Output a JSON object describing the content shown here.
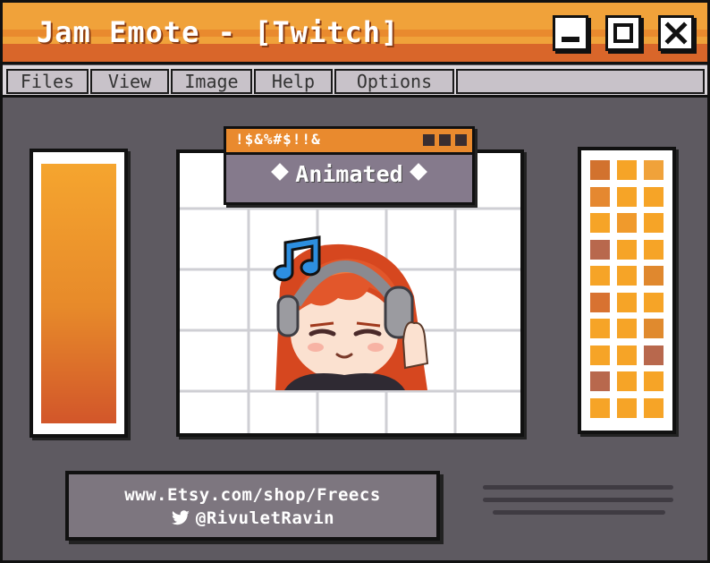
{
  "window": {
    "title": "Jam Emote - [Twitch]",
    "buttons": [
      {
        "name": "minimize",
        "icon": "minimize-icon"
      },
      {
        "name": "maximize",
        "icon": "maximize-icon"
      },
      {
        "name": "close",
        "icon": "close-icon"
      }
    ]
  },
  "menu": {
    "items": [
      "Files",
      "View",
      "Image",
      "Help",
      "Options"
    ]
  },
  "popup": {
    "header": "!$&%#$!!&",
    "label": "Animated"
  },
  "emote": {
    "icon": "music-note-icon",
    "description_icon": "headphones-character-emote"
  },
  "swatches": {
    "colors": [
      [
        "#d2722e",
        "#f6a427",
        "#f0a23a"
      ],
      [
        "#e58830",
        "#f6a427",
        "#f6a427"
      ],
      [
        "#f6a427",
        "#f09a2c",
        "#f6a427"
      ],
      [
        "#b8684d",
        "#f6a427",
        "#f6a427"
      ],
      [
        "#f6a427",
        "#f6a427",
        "#e0882e"
      ],
      [
        "#d87231",
        "#f6a427",
        "#f6a427"
      ],
      [
        "#f6a427",
        "#f6a427",
        "#e08a2e"
      ],
      [
        "#f6a427",
        "#f6a427",
        "#b8684d"
      ],
      [
        "#b8684d",
        "#f6a427",
        "#f6a427"
      ],
      [
        "#f6a427",
        "#f6a427",
        "#f6a427"
      ]
    ]
  },
  "footer": {
    "website": "www.Etsy.com/shop/Freecs",
    "handle": "@RivuletRavin",
    "handle_icon": "twitter-bird-icon"
  },
  "colors": {
    "title_orange": "#f0a23a",
    "title_dark_orange": "#d9662a",
    "body_gray": "#5e5a61",
    "popup_purple": "#857a8c"
  }
}
